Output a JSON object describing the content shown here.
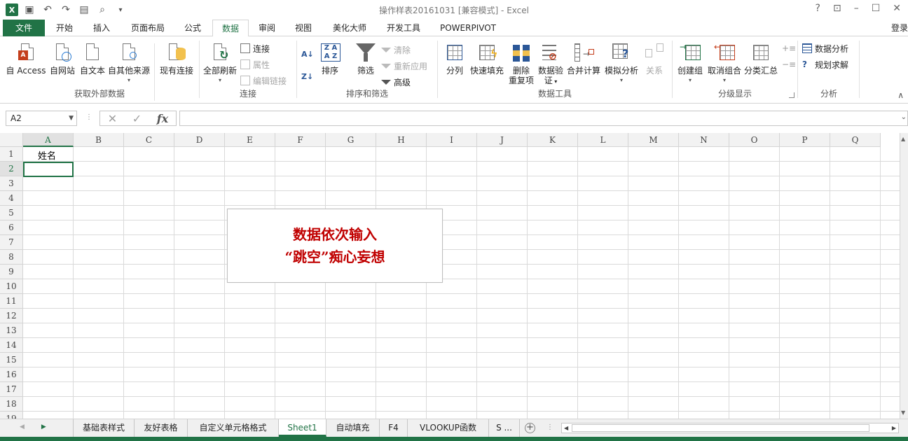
{
  "window": {
    "title": "操作样表20161031  [兼容模式] - Excel",
    "help": "?",
    "login": "登录"
  },
  "tabs": [
    "文件",
    "开始",
    "插入",
    "页面布局",
    "公式",
    "数据",
    "审阅",
    "视图",
    "美化大师",
    "开发工具",
    "POWERPIVOT"
  ],
  "active_tab": "数据",
  "ribbon": {
    "get_external": {
      "label": "获取外部数据",
      "buttons": [
        "自 Access",
        "自网站",
        "自文本",
        "自其他来源",
        "现有连接"
      ]
    },
    "connections": {
      "label": "连接",
      "refresh_all": "全部刷新",
      "connect": "连接",
      "properties": "属性",
      "edit_links": "编辑链接"
    },
    "sort_filter": {
      "label": "排序和筛选",
      "sort": "排序",
      "filter": "筛选",
      "clear": "清除",
      "reapply": "重新应用",
      "advanced": "高级"
    },
    "data_tools": {
      "label": "数据工具",
      "text_to_columns": "分列",
      "flash_fill": "快速填充",
      "remove_dup_1": "删除",
      "remove_dup_2": "重复项",
      "validation_1": "数据验",
      "validation_2": "证",
      "consolidate": "合并计算",
      "what_if": "模拟分析",
      "relationships": "关系"
    },
    "outline": {
      "label": "分级显示",
      "group": "创建组",
      "ungroup": "取消组合",
      "subtotal": "分类汇总"
    },
    "analysis": {
      "label": "分析",
      "data_analysis": "数据分析",
      "solver": "规划求解"
    }
  },
  "formula_bar": {
    "name_box": "A2",
    "fx": "fx",
    "value": ""
  },
  "columns": [
    "A",
    "B",
    "C",
    "D",
    "E",
    "F",
    "G",
    "H",
    "I",
    "J",
    "K",
    "L",
    "M",
    "N",
    "O",
    "P",
    "Q"
  ],
  "rows": [
    "1",
    "2",
    "3",
    "4",
    "5",
    "6",
    "7",
    "8",
    "9",
    "10",
    "11",
    "12",
    "13",
    "14",
    "15",
    "16",
    "17",
    "18",
    "19"
  ],
  "cells": {
    "A1": "姓名"
  },
  "callout": {
    "line1": "数据依次输入",
    "line2": "“跳空”痴心妄想"
  },
  "sheets": [
    "基础表样式",
    "友好表格",
    "自定义单元格格式",
    "Sheet1",
    "自动填充",
    "F4",
    "VLOOKUP函数",
    "S ..."
  ],
  "active_sheet": "Sheet1",
  "colors": {
    "excel_green": "#217346",
    "callout_red": "#c00000"
  }
}
